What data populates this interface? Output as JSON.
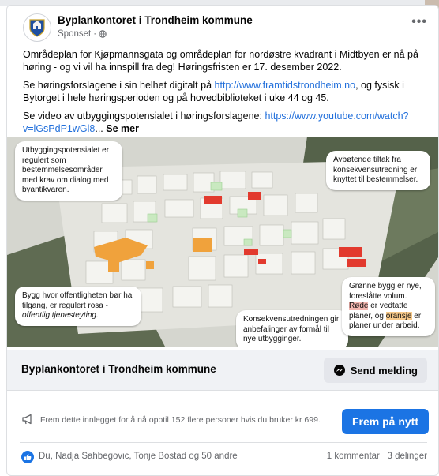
{
  "post": {
    "page_name": "Byplankontoret i Trondheim kommune",
    "sponsored": "Sponset",
    "more": "•••",
    "paragraph1": "Områdeplan for Kjøpmannsgata og områdeplan for nordøstre kvadrant i Midtbyen er nå på høring - og vi vil ha innspill fra deg! Høringsfristen er 17. desember 2022.",
    "paragraph2_a": "Se høringsforslagene i sin helhet digitalt på ",
    "paragraph2_link": "http://www.framtidstrondheim.no",
    "paragraph2_b": ", og fysisk i Bytorget i hele høringsperioden og på hovedbiblioteket i uke 44 og 45.",
    "paragraph3_a": "Se video av utbyggingspotensialet i høringsforslagene: ",
    "paragraph3_link": "https://www.youtube.com/watch?v=lGsPdP1wGl8",
    "paragraph3_ellipsis": "...",
    "see_more": "Se mer"
  },
  "image": {
    "bubble_top_left": "Utbyggingspotensialet er regulert som bestemmelsesområder, med krav om dialog med byantikvaren.",
    "bubble_top_right": "Avbøtende tiltak fra konsekvensutredning er knyttet til bestemmelser.",
    "bubble_bottom_left_a": "Bygg hvor offentligheten bør ha tilgang, er regulert rosa - ",
    "bubble_bottom_left_b": "offentlig tjenesteyting.",
    "bubble_bottom_mid": "Konsekvensutredningen gir anbefalinger av formål til nye utbygginger.",
    "bubble_right_a": "Grønne bygg er nye, foreslåtte volum. ",
    "bubble_right_red": "Røde",
    "bubble_right_b": " er vedtatte planer, og ",
    "bubble_right_orange": "oransje",
    "bubble_right_c": " er planer under arbeid.",
    "colors": {
      "green": "#b9e8b0",
      "red": "#e23a2e",
      "orange": "#f0a23c",
      "pink_highlight": "#f4b7b0",
      "orange_highlight": "#f7c98a"
    }
  },
  "cta": {
    "name": "Byplankontoret i Trondheim kommune",
    "send_label": "Send melding"
  },
  "boost": {
    "text": "Frem dette innlegget for å nå opptil 152 flere personer hvis du bruker kr 699.",
    "button_label": "Frem på nytt"
  },
  "reactions": {
    "names": "Du, Nadja Sahbegovic, Tonje Bostad og 50 andre",
    "comments": "1 kommentar",
    "shares": "3 delinger"
  },
  "accent": "#1b74e4"
}
